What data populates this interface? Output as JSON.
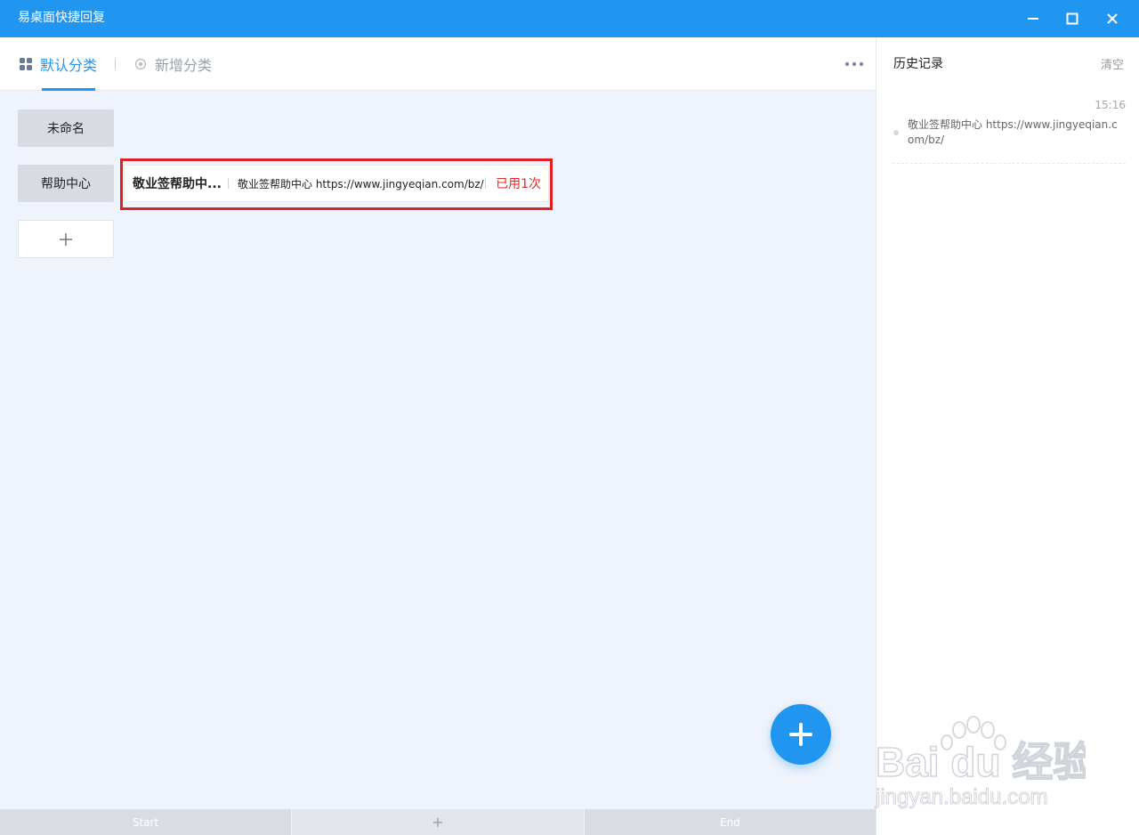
{
  "window": {
    "title": "易桌面快捷回复",
    "controls": [
      "minimize-icon",
      "maximize-icon",
      "close-icon"
    ]
  },
  "tabs": [
    {
      "label": "默认分类",
      "icon": "grid-icon",
      "active": true
    },
    {
      "label": "新增分类",
      "icon": "add-circle-icon",
      "active": false
    }
  ],
  "categories": [
    {
      "label": "未命名"
    },
    {
      "label": "帮助中心"
    }
  ],
  "reply": {
    "title": "敬业签帮助中...",
    "content": "敬业签帮助中心 https://www.jingyeqian.com/bz/",
    "usage": "已用1次"
  },
  "bottombar": {
    "start": "Start",
    "plus": "+",
    "end": "End"
  },
  "history": {
    "title": "历史记录",
    "clear": "清空",
    "entries": [
      {
        "time": "15:16",
        "text": "敬业签帮助中心 https://www.jingyeqian.com/bz/"
      }
    ]
  },
  "watermark": {
    "brand": "Bai du 经验",
    "url": "jingyan.baidu.com"
  },
  "colors": {
    "accent": "#2196f0",
    "highlight": "#e02020",
    "usage": "#e02828"
  }
}
